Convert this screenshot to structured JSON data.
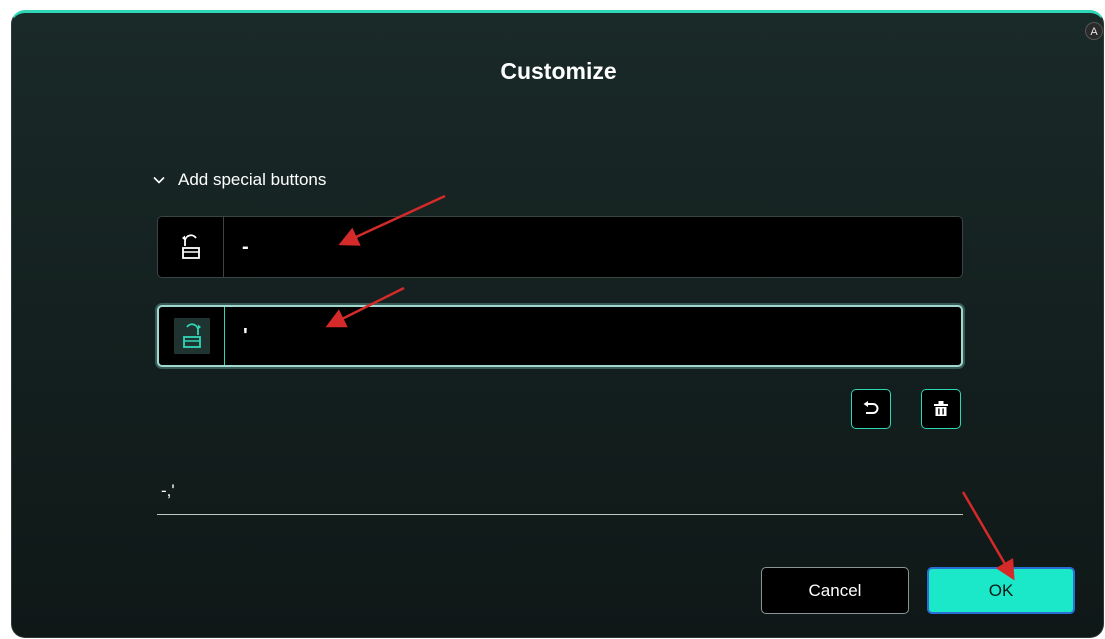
{
  "dialog": {
    "title": "Customize",
    "corner_badge": "A"
  },
  "section": {
    "label": "Add special buttons",
    "expanded": true
  },
  "rows": [
    {
      "icon": "unlock-shift-icon",
      "value": "-"
    },
    {
      "icon": "lock-shift-icon",
      "value": "'"
    }
  ],
  "actions": {
    "undo_icon": "undo-icon",
    "delete_icon": "trash-icon"
  },
  "summary": {
    "value": "-,'"
  },
  "buttons": {
    "cancel": "Cancel",
    "ok": "OK"
  },
  "colors": {
    "accent": "#2fd6b6",
    "ok_fill": "#1be8c8",
    "annotation_arrow": "#d42a2a"
  }
}
